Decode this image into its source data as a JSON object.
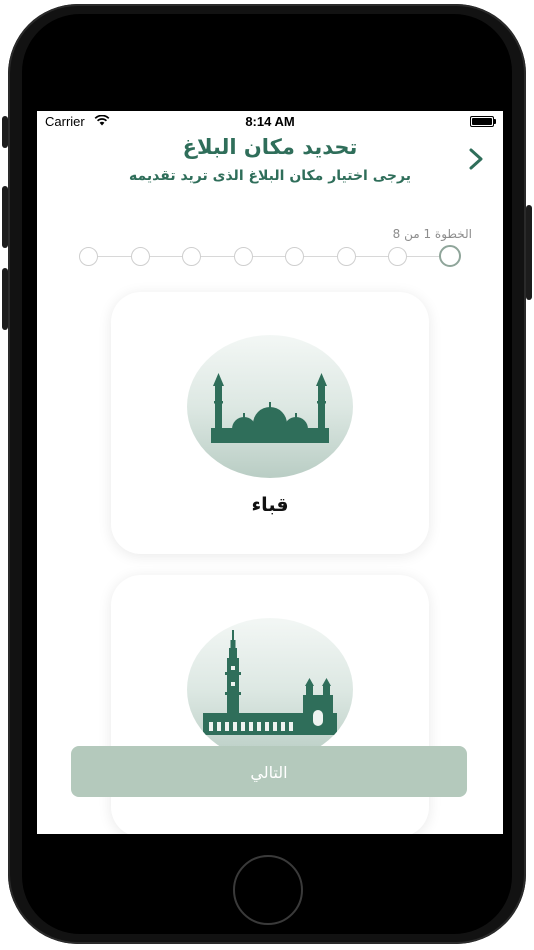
{
  "status_bar": {
    "carrier": "Carrier",
    "time": "8:14 AM",
    "icons": [
      "wifi-icon",
      "battery-icon"
    ]
  },
  "header": {
    "title": "تحديد مكان البلاغ",
    "subtitle": "يرجى اختيار مكان البلاغ الذى تريد تقديمه",
    "back_icon": "chevron-right-icon"
  },
  "progress": {
    "label": "الخطوة  1 من 8",
    "current_step": 1,
    "total_steps": 8
  },
  "locations": [
    {
      "label": "قباء",
      "icon": "quba-mosque-icon"
    },
    {
      "label": "",
      "icon": "prophet-mosque-icon"
    }
  ],
  "actions": {
    "next_label": "التالي",
    "next_enabled": false
  },
  "colors": {
    "primary": "#2f6e5a",
    "disabled_button": "#b4c9bc",
    "image_gradient": "#b9cdc4"
  }
}
